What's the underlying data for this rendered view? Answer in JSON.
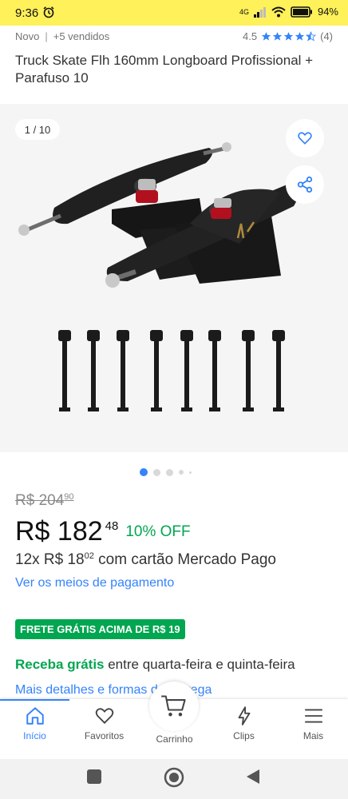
{
  "status_bar": {
    "time": "9:36",
    "network": "4G",
    "battery": "94%"
  },
  "product": {
    "condition": "Novo",
    "sold": "+5 vendidos",
    "rating": "4.5",
    "reviews": "(4)",
    "title": "Truck Skate Flh 160mm Longboard Profissional + Parafuso 10"
  },
  "gallery": {
    "counter": "1 / 10",
    "dots_total": 5,
    "active_dot": 0
  },
  "pricing": {
    "old_price": "R$ 204",
    "old_cents": "90",
    "price": "R$ 182",
    "cents": "48",
    "discount": "10% OFF",
    "installments_prefix": "12x R$ 18",
    "installments_cents": "02",
    "installments_suffix": " com cartão Mercado Pago",
    "payment_link": "Ver os meios de pagamento"
  },
  "shipping": {
    "free_badge": "FRETE GRÁTIS ACIMA DE R$ 19",
    "highlight": "Receba grátis",
    "window": " entre quarta-feira e quinta-feira",
    "details_link": "Mais detalhes e formas de entrega"
  },
  "bottom_nav": {
    "items": [
      {
        "label": "Início",
        "icon": "home-icon",
        "active": true
      },
      {
        "label": "Favoritos",
        "icon": "heart-icon",
        "active": false
      },
      {
        "label": "Carrinho",
        "icon": "cart-icon",
        "active": false
      },
      {
        "label": "Clips",
        "icon": "clips-icon",
        "active": false
      },
      {
        "label": "Mais",
        "icon": "menu-icon",
        "active": false
      }
    ]
  },
  "colors": {
    "brand_yellow": "#fff159",
    "link_blue": "#3483fa",
    "success_green": "#00a650"
  }
}
